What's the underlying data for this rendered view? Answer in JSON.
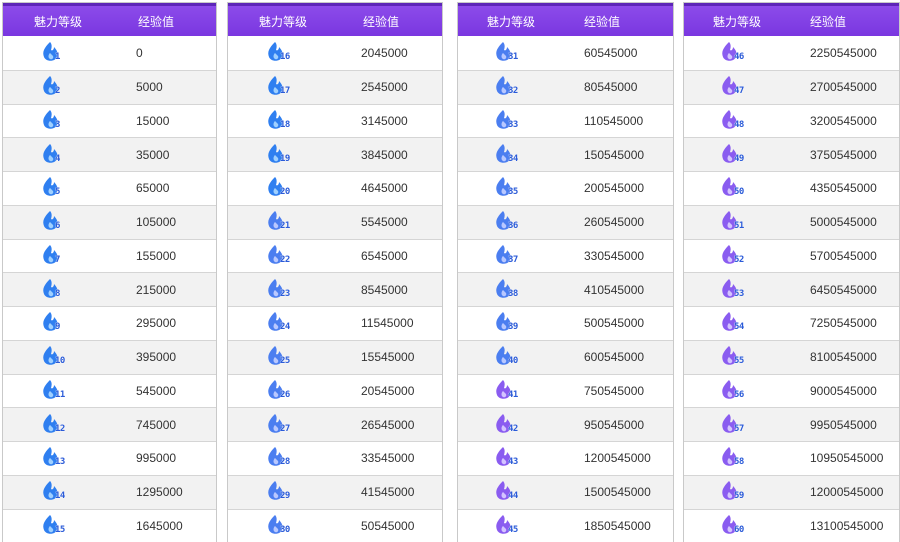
{
  "header": {
    "level_label": "魅力等级",
    "exp_label": "经验值"
  },
  "colors": {
    "header_bg": "#8040e6",
    "flame_blue": "#2f7ff0",
    "flame_purple": "#8a5cf0"
  },
  "tables": [
    {
      "rows": [
        {
          "level": "1",
          "exp": "0"
        },
        {
          "level": "2",
          "exp": "5000"
        },
        {
          "level": "3",
          "exp": "15000"
        },
        {
          "level": "4",
          "exp": "35000"
        },
        {
          "level": "5",
          "exp": "65000"
        },
        {
          "level": "6",
          "exp": "105000"
        },
        {
          "level": "7",
          "exp": "155000"
        },
        {
          "level": "8",
          "exp": "215000"
        },
        {
          "level": "9",
          "exp": "295000"
        },
        {
          "level": "10",
          "exp": "395000"
        },
        {
          "level": "11",
          "exp": "545000"
        },
        {
          "level": "12",
          "exp": "745000"
        },
        {
          "level": "13",
          "exp": "995000"
        },
        {
          "level": "14",
          "exp": "1295000"
        },
        {
          "level": "15",
          "exp": "1645000"
        }
      ]
    },
    {
      "rows": [
        {
          "level": "16",
          "exp": "2045000"
        },
        {
          "level": "17",
          "exp": "2545000"
        },
        {
          "level": "18",
          "exp": "3145000"
        },
        {
          "level": "19",
          "exp": "3845000"
        },
        {
          "level": "20",
          "exp": "4645000"
        },
        {
          "level": "21",
          "exp": "5545000"
        },
        {
          "level": "22",
          "exp": "6545000"
        },
        {
          "level": "23",
          "exp": "8545000"
        },
        {
          "level": "24",
          "exp": "11545000"
        },
        {
          "level": "25",
          "exp": "15545000"
        },
        {
          "level": "26",
          "exp": "20545000"
        },
        {
          "level": "27",
          "exp": "26545000"
        },
        {
          "level": "28",
          "exp": "33545000"
        },
        {
          "level": "29",
          "exp": "41545000"
        },
        {
          "level": "30",
          "exp": "50545000"
        }
      ]
    },
    {
      "rows": [
        {
          "level": "31",
          "exp": "60545000"
        },
        {
          "level": "32",
          "exp": "80545000"
        },
        {
          "level": "33",
          "exp": "110545000"
        },
        {
          "level": "34",
          "exp": "150545000"
        },
        {
          "level": "35",
          "exp": "200545000"
        },
        {
          "level": "36",
          "exp": "260545000"
        },
        {
          "level": "37",
          "exp": "330545000"
        },
        {
          "level": "38",
          "exp": "410545000"
        },
        {
          "level": "39",
          "exp": "500545000"
        },
        {
          "level": "40",
          "exp": "600545000"
        },
        {
          "level": "41",
          "exp": "750545000"
        },
        {
          "level": "42",
          "exp": "950545000"
        },
        {
          "level": "43",
          "exp": "1200545000"
        },
        {
          "level": "44",
          "exp": "1500545000"
        },
        {
          "level": "45",
          "exp": "1850545000"
        }
      ]
    },
    {
      "rows": [
        {
          "level": "46",
          "exp": "2250545000"
        },
        {
          "level": "47",
          "exp": "2700545000"
        },
        {
          "level": "48",
          "exp": "3200545000"
        },
        {
          "level": "49",
          "exp": "3750545000"
        },
        {
          "level": "50",
          "exp": "4350545000"
        },
        {
          "level": "51",
          "exp": "5000545000"
        },
        {
          "level": "52",
          "exp": "5700545000"
        },
        {
          "level": "53",
          "exp": "6450545000"
        },
        {
          "level": "54",
          "exp": "7250545000"
        },
        {
          "level": "55",
          "exp": "8100545000"
        },
        {
          "level": "56",
          "exp": "9000545000"
        },
        {
          "level": "57",
          "exp": "9950545000"
        },
        {
          "level": "58",
          "exp": "10950545000"
        },
        {
          "level": "59",
          "exp": "12000545000"
        },
        {
          "level": "60",
          "exp": "13100545000"
        }
      ]
    }
  ]
}
